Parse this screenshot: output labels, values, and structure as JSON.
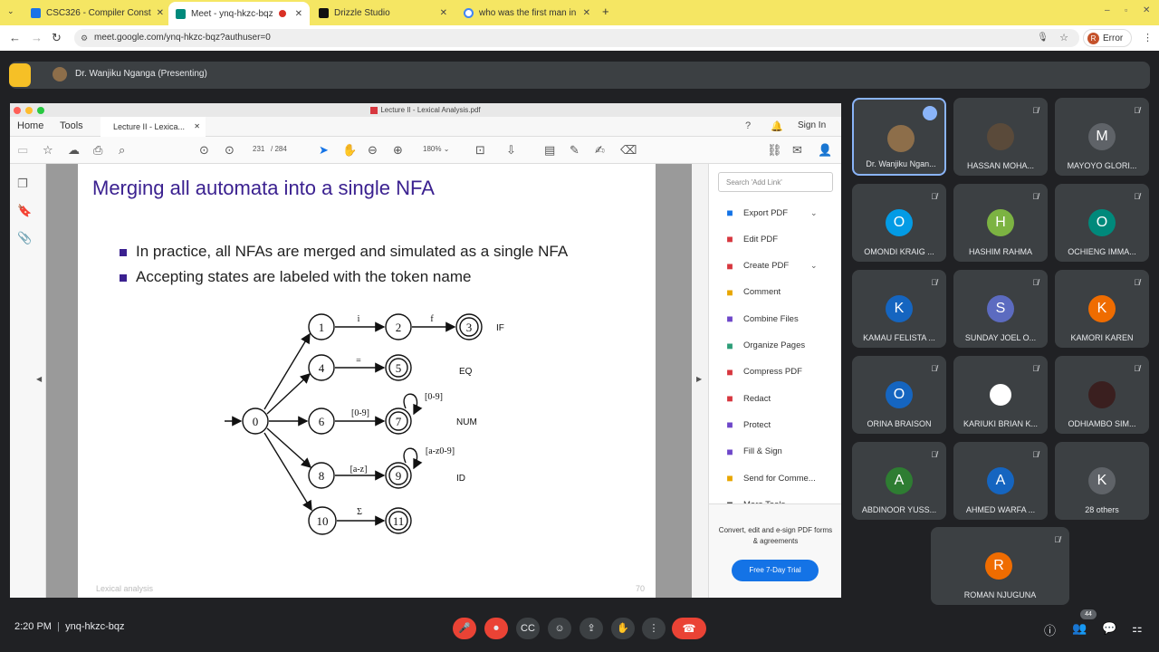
{
  "browser": {
    "tabs": [
      {
        "label": "CSC326 - Compiler Const",
        "favicon_color": "#1a73e8"
      },
      {
        "label": "Meet - ynq-hkzc-bqz",
        "favicon_color": "#00897b",
        "active": true
      },
      {
        "label": "Drizzle Studio",
        "favicon_color": "#111111"
      },
      {
        "label": "who was the first man in",
        "favicon_color": "#4285f4"
      }
    ],
    "url": "meet.google.com/ynq-hkzc-bqz?authuser=0",
    "profile_initial": "R",
    "profile_status": "Error"
  },
  "meet": {
    "presenter_label": "Dr. Wanjiku Nganga (Presenting)",
    "meeting_time": "2:20 PM",
    "meeting_code": "ynq-hkzc-bqz",
    "people_count": "44"
  },
  "pdf": {
    "window_title": "Lecture II - Lexical Analysis.pdf",
    "menu": {
      "home": "Home",
      "tools": "Tools",
      "doc_tab": "Lecture II - Lexica...",
      "sign_in": "Sign In"
    },
    "page_current": "231",
    "page_total": "/ 284",
    "zoom": "180%",
    "search_placeholder": "Search 'Add Link'",
    "tools": [
      {
        "label": "Export PDF",
        "icon": "export-pdf-icon",
        "color": "#1473e6",
        "chevron": true
      },
      {
        "label": "Edit PDF",
        "icon": "edit-pdf-icon",
        "color": "#d7373f",
        "chevron": false
      },
      {
        "label": "Create PDF",
        "icon": "create-pdf-icon",
        "color": "#d7373f",
        "chevron": true
      },
      {
        "label": "Comment",
        "icon": "comment-icon",
        "color": "#e8a600",
        "chevron": false
      },
      {
        "label": "Combine Files",
        "icon": "combine-files-icon",
        "color": "#6e47c9",
        "chevron": false
      },
      {
        "label": "Organize Pages",
        "icon": "organize-pages-icon",
        "color": "#2d9d78",
        "chevron": false
      },
      {
        "label": "Compress PDF",
        "icon": "compress-pdf-icon",
        "color": "#d7373f",
        "chevron": false
      },
      {
        "label": "Redact",
        "icon": "redact-icon",
        "color": "#d7373f",
        "chevron": false
      },
      {
        "label": "Protect",
        "icon": "protect-icon",
        "color": "#6e47c9",
        "chevron": false
      },
      {
        "label": "Fill & Sign",
        "icon": "fill-sign-icon",
        "color": "#6e47c9",
        "chevron": false
      },
      {
        "label": "Send for Comme...",
        "icon": "send-comments-icon",
        "color": "#e8a600",
        "chevron": false
      },
      {
        "label": "More Tools",
        "icon": "more-tools-icon",
        "color": "#555555",
        "chevron": false
      }
    ],
    "promo_text": "Convert, edit and e-sign PDF forms & agreements",
    "promo_button": "Free 7-Day Trial"
  },
  "slide": {
    "title": "Merging all automata into a single NFA",
    "bullets": [
      "In practice, all NFAs are merged and simulated as a single NFA",
      "Accepting states are labeled with the token name"
    ],
    "footer_left": "Lexical analysis",
    "footer_right": "70",
    "nfa": {
      "states": [
        "0",
        "1",
        "2",
        "3",
        "4",
        "5",
        "6",
        "7",
        "8",
        "9",
        "10",
        "11"
      ],
      "edge_labels": [
        "i",
        "f",
        "=",
        "[0-9]",
        "[0-9]",
        "[a-z]",
        "[a-z0-9]",
        "Σ"
      ],
      "tokens": [
        "IF",
        "EQ",
        "NUM",
        "ID"
      ]
    }
  },
  "participants": [
    {
      "name": "Dr. Wanjiku Ngan...",
      "initial": "",
      "color": "#8d6e4a",
      "speaking": true,
      "photo": true
    },
    {
      "name": "HASSAN MOHA...",
      "initial": "",
      "color": "#5a4a3a",
      "speaking": false,
      "photo": true
    },
    {
      "name": "MAYOYO GLORI...",
      "initial": "M",
      "color": "#5f6368",
      "speaking": false,
      "photo": false
    },
    {
      "name": "OMONDI KRAIG ...",
      "initial": "O",
      "color": "#039be5",
      "speaking": false,
      "photo": false
    },
    {
      "name": "HASHIM RAHMA",
      "initial": "H",
      "color": "#7cb342",
      "speaking": false,
      "photo": false
    },
    {
      "name": "OCHIENG IMMA...",
      "initial": "O",
      "color": "#00897b",
      "speaking": false,
      "photo": false
    },
    {
      "name": "KAMAU FELISTA ...",
      "initial": "K",
      "color": "#1565c0",
      "speaking": false,
      "photo": false
    },
    {
      "name": "SUNDAY JOEL O...",
      "initial": "S",
      "color": "#5c6bc0",
      "speaking": false,
      "photo": false
    },
    {
      "name": "KAMORI KAREN",
      "initial": "K",
      "color": "#ef6c00",
      "speaking": false,
      "photo": false
    },
    {
      "name": "ORINA BRAISON",
      "initial": "O",
      "color": "#1565c0",
      "speaking": false,
      "photo": false
    },
    {
      "name": "KARIUKI BRIAN K...",
      "initial": "",
      "color": "#ffffff",
      "speaking": false,
      "photo": true
    },
    {
      "name": "ODHIAMBO SIM...",
      "initial": "",
      "color": "#3a1f1f",
      "speaking": false,
      "photo": true
    },
    {
      "name": "ABDINOOR YUSS...",
      "initial": "A",
      "color": "#2e7d32",
      "speaking": false,
      "photo": false
    },
    {
      "name": "AHMED WARFA ...",
      "initial": "A",
      "color": "#1565c0",
      "speaking": false,
      "photo": false
    },
    {
      "name": "28 others",
      "initial": "K",
      "color": "#5f6368",
      "speaking": false,
      "photo": false
    },
    {
      "name": "ROMAN NJUGUNA",
      "initial": "R",
      "color": "#ef6c00",
      "speaking": false,
      "photo": false
    }
  ]
}
